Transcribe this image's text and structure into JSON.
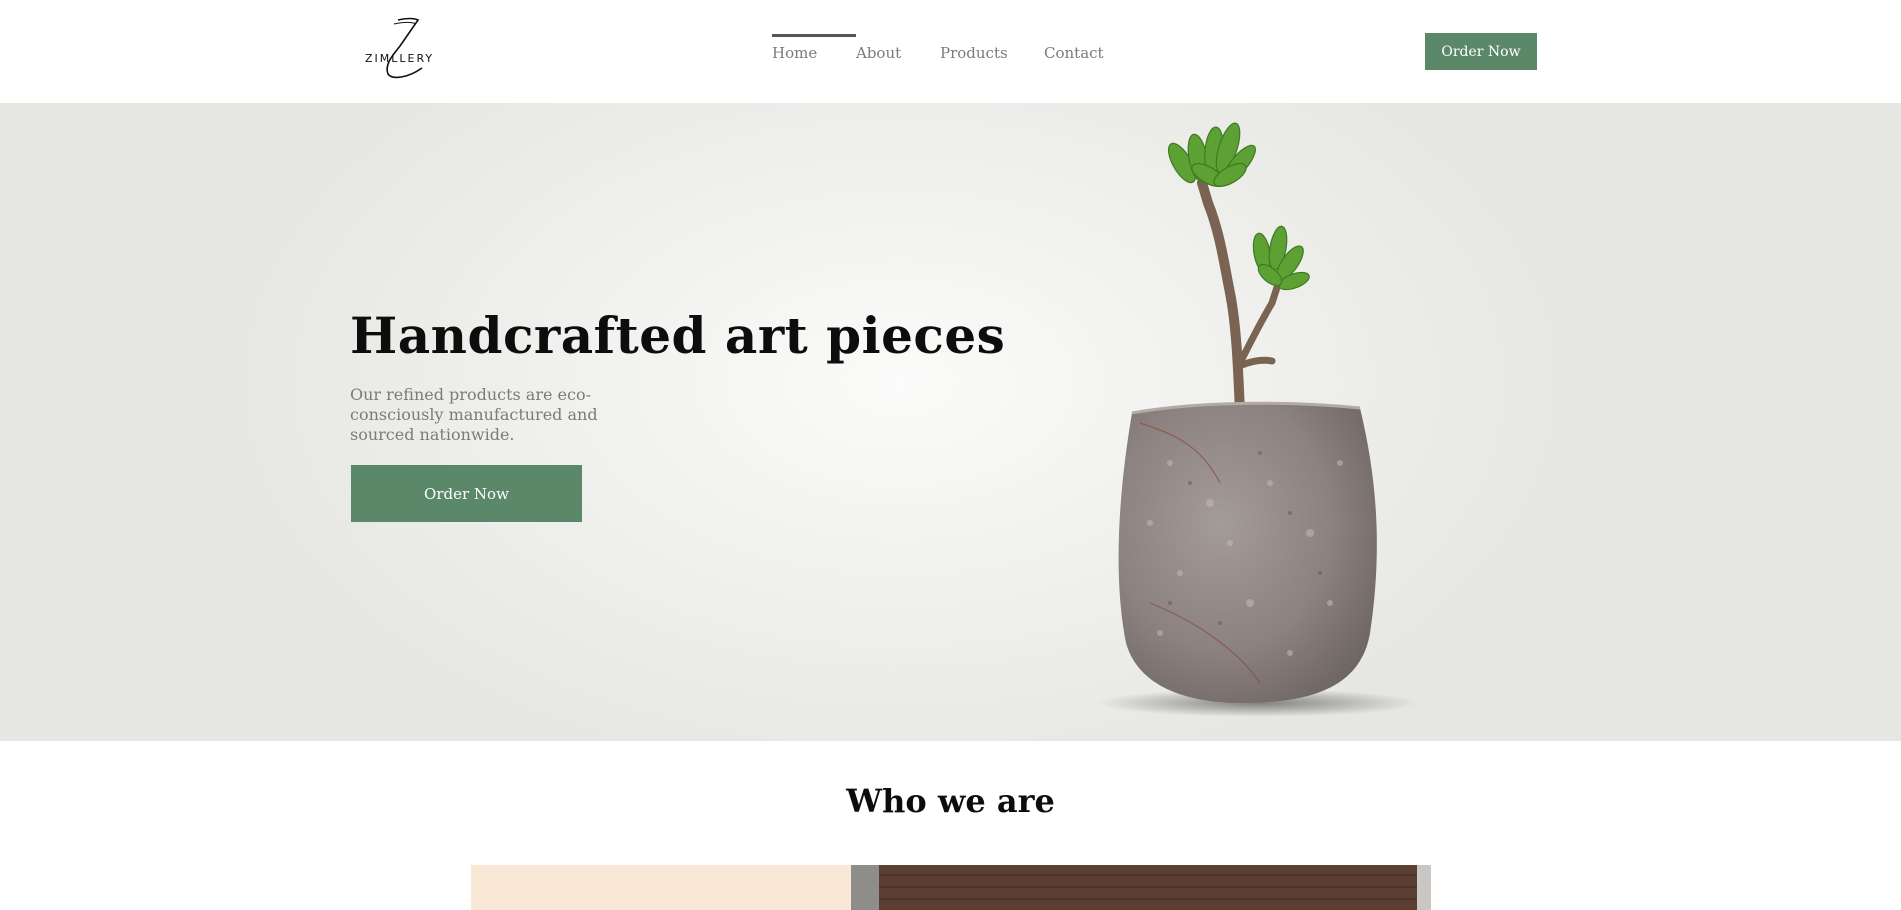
{
  "header": {
    "logo_text": "ZIMLLERY",
    "nav": [
      {
        "label": "Home",
        "active": true
      },
      {
        "label": "About",
        "active": false
      },
      {
        "label": "Products",
        "active": false
      },
      {
        "label": "Contact",
        "active": false
      }
    ],
    "cta_label": "Order Now"
  },
  "hero": {
    "title": "Handcrafted art pieces",
    "subtitle": "Our refined products are eco-consciously manufactured and sourced nationwide.",
    "cta_label": "Order Now"
  },
  "who_we_are": {
    "title": "Who we are"
  },
  "colors": {
    "accent": "#5b8869",
    "hero_bg": "#ecece9",
    "panel_left": "#f8e8d5"
  }
}
